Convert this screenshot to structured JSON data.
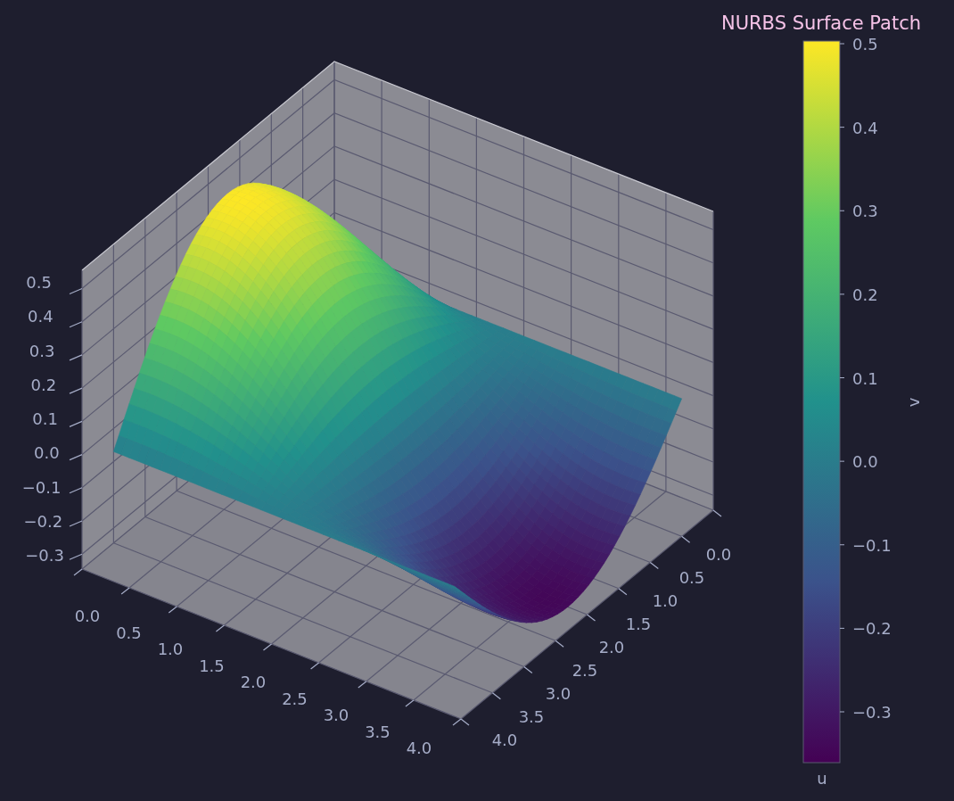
{
  "title": "NURBS Surface Patch",
  "plot": {
    "z_ticks": [
      "0.5",
      "0.4",
      "0.3",
      "0.2",
      "0.1",
      "0.0",
      "−0.1",
      "−0.2",
      "−0.3"
    ],
    "x_ticks": [
      "0.0",
      "0.5",
      "1.0",
      "1.5",
      "2.0",
      "2.5",
      "3.0",
      "3.5",
      "4.0"
    ],
    "y_ticks": [
      "0.0",
      "0.5",
      "1.0",
      "1.5",
      "2.0",
      "2.5",
      "3.0",
      "3.5",
      "4.0"
    ]
  },
  "colorbar": {
    "ticks": [
      "0.5",
      "0.4",
      "0.3",
      "0.2",
      "0.1",
      "0.0",
      "−0.1",
      "−0.2",
      "−0.3"
    ],
    "label": "v",
    "bottom_label": "u"
  }
}
